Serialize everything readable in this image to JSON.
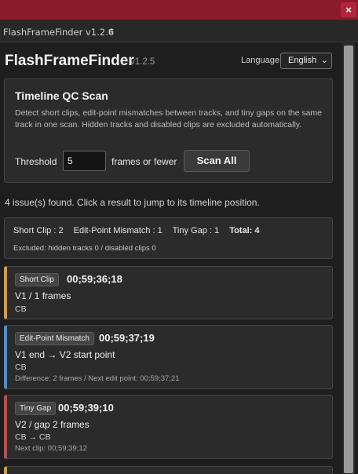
{
  "window": {
    "close_label": "×",
    "tab_title": "FlashFrameFinder v1.2.6",
    "tab_menu_icon": "≡"
  },
  "header": {
    "app_name": "FlashFrameFinder",
    "version": "v1.2.5",
    "language_label": "Language",
    "language_value": "English"
  },
  "scan": {
    "title": "Timeline QC Scan",
    "description": "Detect short clips, edit-point mismatches between tracks, and tiny gaps on the same track in one scan. Hidden tracks and disabled clips are excluded automatically.",
    "threshold_label": "Threshold",
    "threshold_value": "5",
    "threshold_suffix": "frames or fewer",
    "scan_button": "Scan All"
  },
  "results": {
    "summary_line": "4 issue(s) found. Click a result to jump to its timeline position.",
    "counts": {
      "short_clip": "Short Clip : 2",
      "mismatch": "Edit-Point Mismatch : 1",
      "tiny_gap": "Tiny Gap : 1",
      "total": "Total: 4"
    },
    "excluded": "Excluded: hidden tracks 0 / disabled clips 0"
  },
  "issues": [
    {
      "type": "Short Clip",
      "timecode": "00;59;36;18",
      "main": "V1 / 1 frames",
      "sub": "CB",
      "detail": "",
      "color": "#d99d3a"
    },
    {
      "type": "Edit-Point Mismatch",
      "timecode": "00;59;37;19",
      "main": "V1 end → V2 start point",
      "sub": "CB",
      "detail": "Difference: 2 frames / Next edit point: 00;59;37;21",
      "color": "#4a90d9"
    },
    {
      "type": "Tiny Gap",
      "timecode": "00;59;39;10",
      "main": "V2 / gap 2 frames",
      "sub": "CB → CB",
      "detail": "Next clip: 00;59;39;12",
      "color": "#c44a4a"
    }
  ],
  "colors": {
    "titlebar": "#8a1b2b",
    "background": "#1e1e1e",
    "card": "#2b2b2b"
  }
}
